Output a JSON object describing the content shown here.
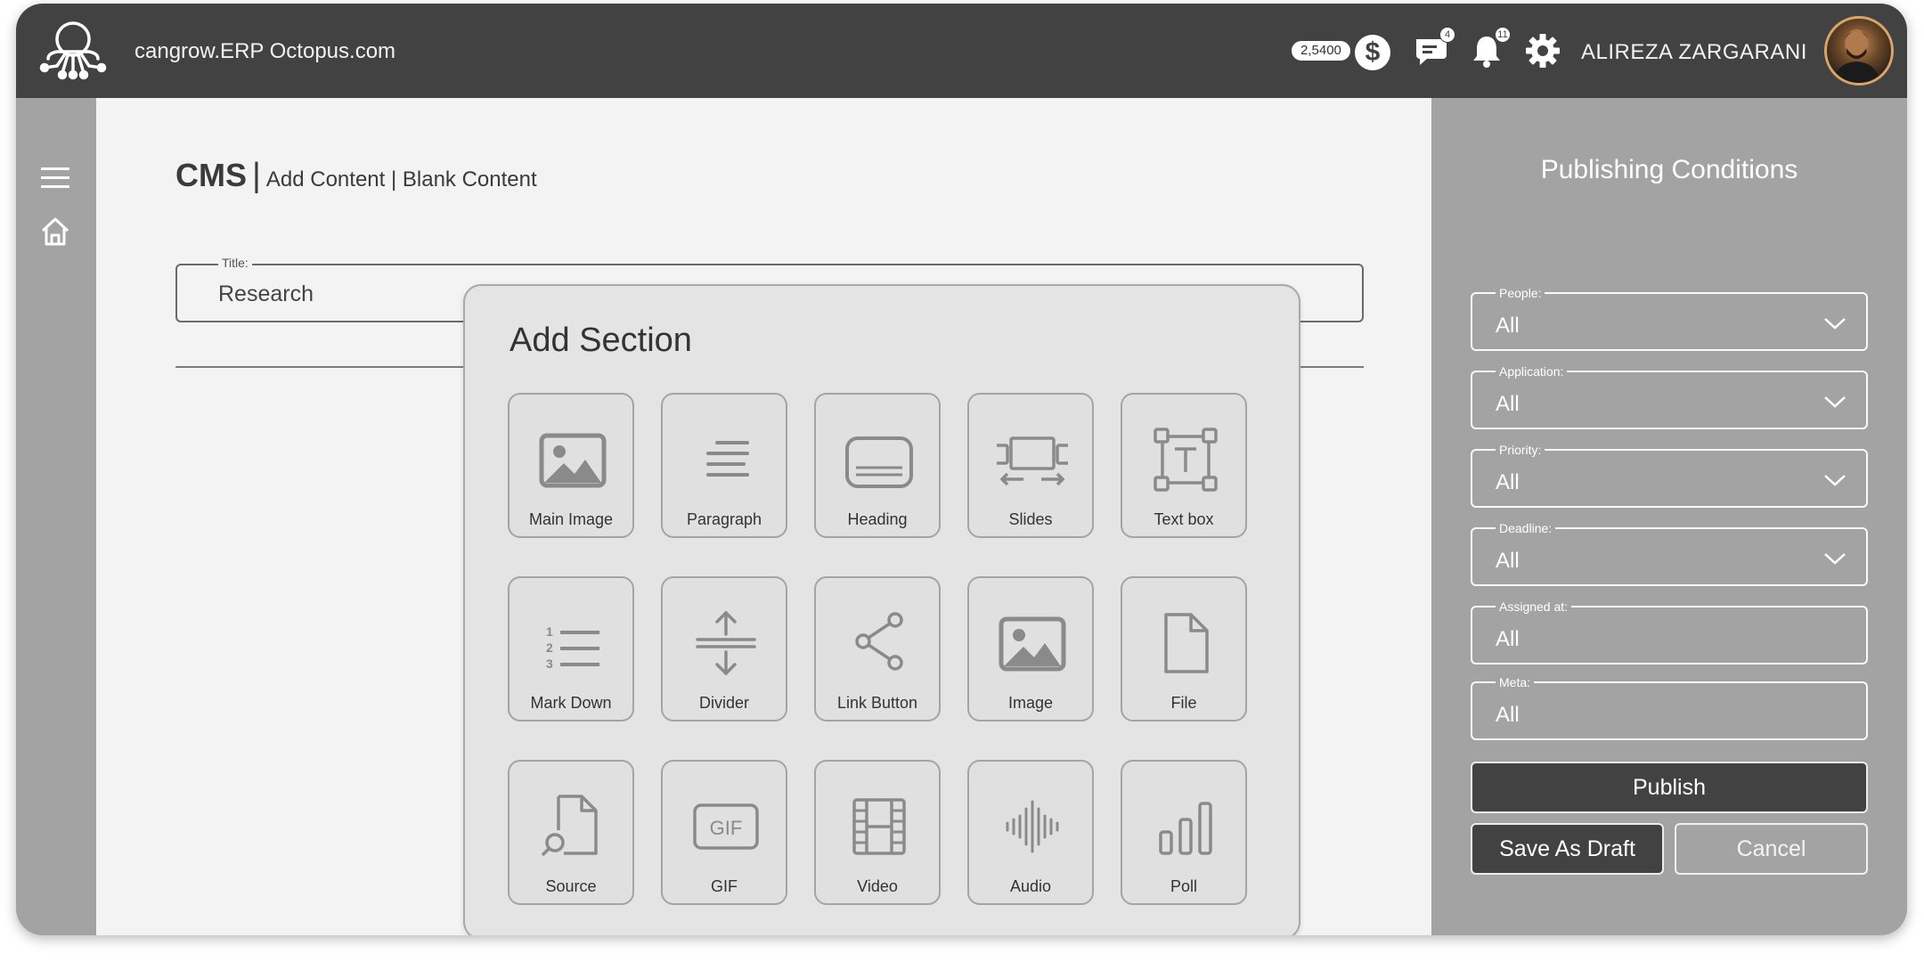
{
  "header": {
    "app_title": "cangrow.ERP Octopus.com",
    "balance": "2,5400",
    "currency_symbol": "$",
    "messages_badge": "4",
    "notifications_badge": "11",
    "user_name": "ALIREZA ZARGARANI"
  },
  "sidebar": {
    "items": [
      {
        "icon": "menu-icon"
      },
      {
        "icon": "home-icon"
      }
    ]
  },
  "main": {
    "breadcrumb": {
      "section": "CMS",
      "separator": "|",
      "path": "Add Content | Blank Content"
    },
    "title_field": {
      "label": "Title:",
      "value": "Research"
    }
  },
  "modal": {
    "title": "Add Section",
    "tiles": [
      {
        "label": "Main Image",
        "icon": "image-icon"
      },
      {
        "label": "Paragraph",
        "icon": "paragraph-icon"
      },
      {
        "label": "Heading",
        "icon": "heading-icon"
      },
      {
        "label": "Slides",
        "icon": "slides-icon"
      },
      {
        "label": "Text box",
        "icon": "text-box-icon"
      },
      {
        "label": "Mark Down",
        "icon": "numbered-list-icon"
      },
      {
        "label": "Divider",
        "icon": "divider-icon"
      },
      {
        "label": "Link Button",
        "icon": "share-icon"
      },
      {
        "label": "Image",
        "icon": "image-icon"
      },
      {
        "label": "File",
        "icon": "file-icon"
      },
      {
        "label": "Source",
        "icon": "source-search-icon"
      },
      {
        "label": "GIF",
        "icon": "gif-icon"
      },
      {
        "label": "Video",
        "icon": "film-icon"
      },
      {
        "label": "Audio",
        "icon": "audio-wave-icon"
      },
      {
        "label": "Poll",
        "icon": "bar-chart-icon"
      }
    ]
  },
  "publishing": {
    "title": "Publishing Conditions",
    "fields": [
      {
        "label": "People:",
        "value": "All"
      },
      {
        "label": "Application:",
        "value": "All"
      },
      {
        "label": "Priority:",
        "value": "All"
      },
      {
        "label": "Deadline:",
        "value": "All"
      },
      {
        "label": "Assigned at:",
        "value": "All"
      },
      {
        "label": "Meta:",
        "value": "All"
      }
    ],
    "publish_label": "Publish",
    "draft_label": "Save As Draft",
    "cancel_label": "Cancel"
  },
  "colors": {
    "topbar": "#424242",
    "side_panels": "#a3a3a3",
    "content_bg": "#f3f3f3",
    "modal_bg": "#e4e4e4"
  }
}
